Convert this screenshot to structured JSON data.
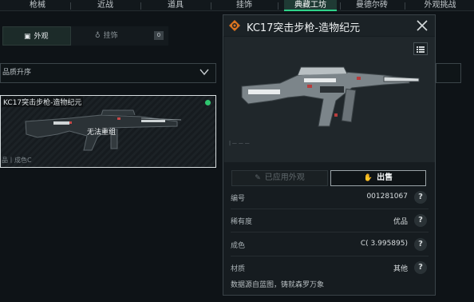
{
  "topnav": {
    "tabs": [
      "枪械",
      "近战",
      "道具",
      "挂饰",
      "典藏工坊",
      "曼德尔砖",
      "外观挑战"
    ],
    "active_index": 4
  },
  "subtabs": {
    "appearance": "外观",
    "pendant": "挂饰",
    "pendant_count": "0"
  },
  "sort": {
    "label": "品质升序"
  },
  "card": {
    "name": "KC17突击步枪-造物纪元",
    "status": "无法重组",
    "meta": "品丨成色C",
    "online_color": "#2fc66f"
  },
  "panel": {
    "title": "KC17突击步枪-造物纪元",
    "applied_button": "已应用外观",
    "sell_button": "出售",
    "rows": [
      {
        "key": "编号",
        "value": "001281067"
      },
      {
        "key": "稀有度",
        "value": "优品"
      },
      {
        "key": "成色",
        "value": "C( 3.995895)"
      },
      {
        "key": "材质",
        "value": "其他"
      }
    ],
    "description": "数据源自蓝图，铸就森罗万象",
    "help_glyph": "?"
  },
  "colors": {
    "accent_green": "#2fd38a",
    "brand_orange": "#d9731f"
  }
}
